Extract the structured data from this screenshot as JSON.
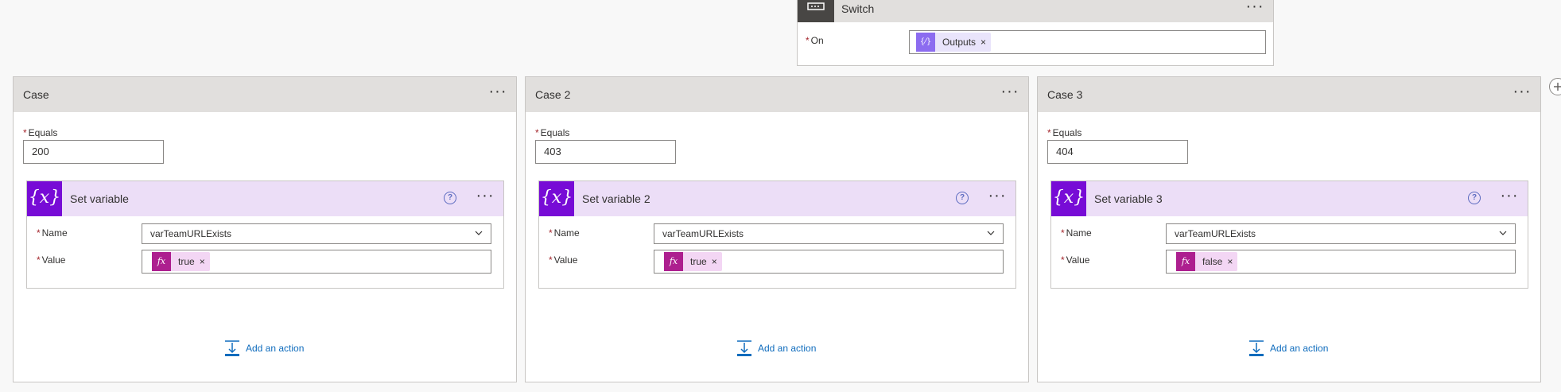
{
  "switch": {
    "title": "Switch",
    "on_label": "On",
    "token": "Outputs",
    "token_close": "×"
  },
  "cases": [
    {
      "title": "Case",
      "equals_label": "Equals",
      "equals_value": "200",
      "action": {
        "title": "Set variable",
        "name_label": "Name",
        "name_value": "varTeamURLExists",
        "value_label": "Value",
        "value_token": "true",
        "token_close": "×"
      },
      "add_action": "Add an action"
    },
    {
      "title": "Case 2",
      "equals_label": "Equals",
      "equals_value": "403",
      "action": {
        "title": "Set variable 2",
        "name_label": "Name",
        "name_value": "varTeamURLExists",
        "value_label": "Value",
        "value_token": "true",
        "token_close": "×"
      },
      "add_action": "Add an action"
    },
    {
      "title": "Case 3",
      "equals_label": "Equals",
      "equals_value": "404",
      "action": {
        "title": "Set variable 3",
        "name_label": "Name",
        "name_value": "varTeamURLExists",
        "value_label": "Value",
        "value_token": "false",
        "token_close": "×"
      },
      "add_action": "Add an action"
    }
  ],
  "ui": {
    "ellipsis": "···",
    "help": "?",
    "required": "*",
    "fx": "fx",
    "expr_icon": "{x}",
    "var_icon": "{⁄}"
  },
  "colors": {
    "accent_purple": "#770bd6",
    "token_pink": "#f3d6f4",
    "link_blue": "#0f6cbd"
  }
}
